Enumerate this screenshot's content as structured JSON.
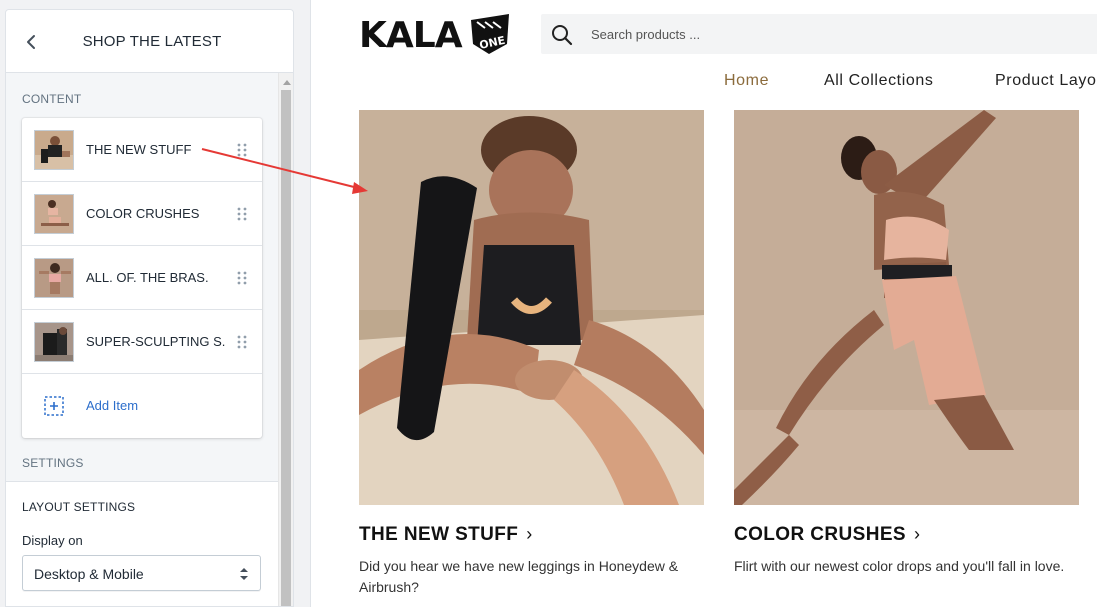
{
  "sidebar": {
    "title": "SHOP THE LATEST",
    "content_label": "CONTENT",
    "items": [
      {
        "label": "THE NEW STUFF"
      },
      {
        "label": "COLOR CRUSHES"
      },
      {
        "label": "ALL. OF. THE BRAS."
      },
      {
        "label": "SUPER-SCULPTING S..."
      }
    ],
    "add_item_label": "Add Item",
    "settings_label": "SETTINGS",
    "layout_settings_title": "LAYOUT SETTINGS",
    "display_on_label": "Display on",
    "display_on_value": "Desktop & Mobile"
  },
  "store": {
    "logo_text": "KALA",
    "logo_badge": "ONE",
    "search_placeholder": "Search products ...",
    "nav": [
      {
        "label": "Home"
      },
      {
        "label": "All Collections"
      },
      {
        "label": "Product Layo"
      }
    ],
    "cards": [
      {
        "title": "THE NEW STUFF",
        "description": "Did you hear we have new leggings in Honeydew & Airbrush?"
      },
      {
        "title": "COLOR CRUSHES",
        "description": "Flirt with our newest color drops and you'll fall in love."
      }
    ]
  },
  "colors": {
    "accent_link": "#2c6ecb",
    "nav_active": "#8b6b3c",
    "annotation_arrow": "#e53935"
  }
}
